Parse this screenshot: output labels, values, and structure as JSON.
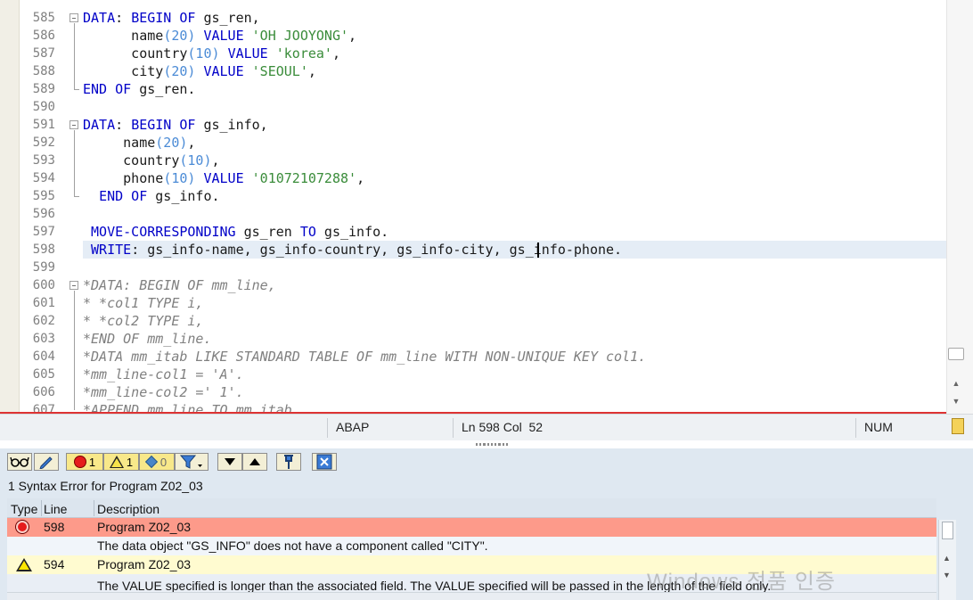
{
  "editor": {
    "lines": [
      {
        "n": "585",
        "tokens": [
          [
            "kw",
            "DATA"
          ],
          [
            "",
            "Ø "
          ],
          [
            "kw",
            "BEGIN OF"
          ],
          [
            "",
            " gs_ren,"
          ]
        ]
      },
      {
        "n": "586",
        "tokens": [
          [
            "",
            "      name"
          ],
          [
            "num",
            "(20)"
          ],
          [
            "",
            " "
          ],
          [
            "kw",
            "VALUE"
          ],
          [
            "",
            " "
          ],
          [
            "str",
            "'OH JOOYONG'"
          ],
          [
            "",
            ","
          ]
        ]
      },
      {
        "n": "587",
        "tokens": [
          [
            "",
            "      country"
          ],
          [
            "num",
            "(10)"
          ],
          [
            "",
            " "
          ],
          [
            "kw",
            "VALUE"
          ],
          [
            "",
            " "
          ],
          [
            "str",
            "'korea'"
          ],
          [
            "",
            ","
          ]
        ]
      },
      {
        "n": "588",
        "tokens": [
          [
            "",
            "      city"
          ],
          [
            "num",
            "(20)"
          ],
          [
            "",
            " "
          ],
          [
            "kw",
            "VALUE"
          ],
          [
            "",
            " "
          ],
          [
            "str",
            "'SEOUL'"
          ],
          [
            "",
            ","
          ]
        ]
      },
      {
        "n": "589",
        "tokens": [
          [
            "kw",
            "END OF"
          ],
          [
            "",
            " gs_ren."
          ]
        ]
      },
      {
        "n": "590",
        "tokens": []
      },
      {
        "n": "591",
        "tokens": [
          [
            "kw",
            "DATA"
          ],
          [
            "",
            "Ø "
          ],
          [
            "kw",
            "BEGIN OF"
          ],
          [
            "",
            " gs_info,"
          ]
        ]
      },
      {
        "n": "592",
        "tokens": [
          [
            "",
            "     name"
          ],
          [
            "num",
            "(20)"
          ],
          [
            "",
            ","
          ]
        ]
      },
      {
        "n": "593",
        "tokens": [
          [
            "",
            "     country"
          ],
          [
            "num",
            "(10)"
          ],
          [
            "",
            ","
          ]
        ]
      },
      {
        "n": "594",
        "tokens": [
          [
            "",
            "     phone"
          ],
          [
            "num",
            "(10)"
          ],
          [
            "",
            " "
          ],
          [
            "kw",
            "VALUE"
          ],
          [
            "",
            " "
          ],
          [
            "str",
            "'01072107288'"
          ],
          [
            "",
            ","
          ]
        ]
      },
      {
        "n": "595",
        "tokens": [
          [
            "",
            "  "
          ],
          [
            "kw",
            "END OF"
          ],
          [
            "",
            " gs_info."
          ]
        ]
      },
      {
        "n": "596",
        "tokens": []
      },
      {
        "n": "597",
        "tokens": [
          [
            "",
            " "
          ],
          [
            "kw",
            "MOVE-CORRESPONDING"
          ],
          [
            "",
            " gs_ren "
          ],
          [
            "kw",
            "TO"
          ],
          [
            "",
            " gs_info."
          ]
        ]
      },
      {
        "n": "598",
        "tokens": [
          [
            "",
            " "
          ],
          [
            "kw",
            "WRITE"
          ],
          [
            "",
            "Ø gs_info-name, gs_info-country, gs_info-city, gs_info-phone."
          ]
        ]
      },
      {
        "n": "599",
        "tokens": []
      },
      {
        "n": "600",
        "tokens": [
          [
            "cmt",
            "*DATA: BEGIN OF mm_line,"
          ]
        ]
      },
      {
        "n": "601",
        "tokens": [
          [
            "cmt",
            "* *col1 TYPE i,"
          ]
        ]
      },
      {
        "n": "602",
        "tokens": [
          [
            "cmt",
            "* *col2 TYPE i,"
          ]
        ]
      },
      {
        "n": "603",
        "tokens": [
          [
            "cmt",
            "*END OF mm_line."
          ]
        ]
      },
      {
        "n": "604",
        "tokens": [
          [
            "cmt",
            "*DATA mm_itab LIKE STANDARD TABLE OF mm_line WITH NON-UNIQUE KEY col1."
          ]
        ]
      },
      {
        "n": "605",
        "tokens": [
          [
            "cmt",
            "*mm_line-col1 = 'A'."
          ]
        ]
      },
      {
        "n": "606",
        "tokens": [
          [
            "cmt",
            "*mm_line-col2 =' 1'."
          ]
        ]
      },
      {
        "n": "607",
        "tokens": [
          [
            "cmt",
            "*APPEND mm_line TO mm_itab."
          ]
        ]
      }
    ]
  },
  "statusbar": {
    "language": "ABAP",
    "position": "Ln 598 Col  52",
    "num": "NUM"
  },
  "toolbar": {
    "error_count": "1",
    "warning_count": "1",
    "info_count": "0"
  },
  "panel": {
    "title": "1 Syntax Error for Program Z02_03",
    "columns": {
      "type": "Type",
      "line": "Line",
      "description": "Description"
    },
    "rows": [
      {
        "kind": "error",
        "line": "598",
        "program": "Program Z02_03",
        "message": "The data object \"GS_INFO\" does not have a component called \"CITY\"."
      },
      {
        "kind": "warning",
        "line": "594",
        "program": "Program Z02_03",
        "message": "The VALUE specified is longer than the associated field. The VALUE specified will be passed in the length of the field only."
      }
    ]
  },
  "watermark": "Windows 정품 인증",
  "colors": {
    "keyword": "#0000c8",
    "string": "#3a8c3a",
    "number": "#4b8bd6",
    "comment": "#808080",
    "error_row": "#fd9a8a",
    "warning_row": "#fffbd0"
  }
}
